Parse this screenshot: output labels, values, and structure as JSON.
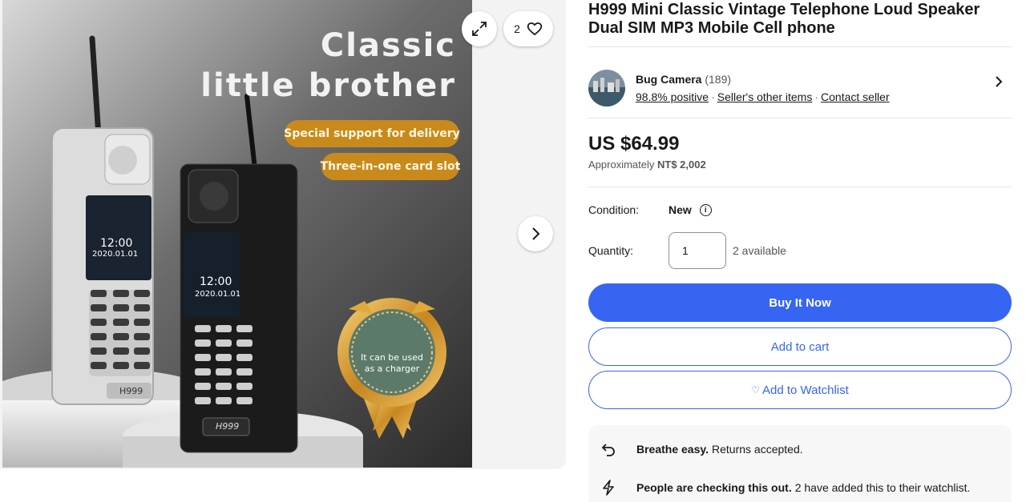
{
  "gallery": {
    "headline_1": "Classic",
    "headline_2": "little brother",
    "badge_1": "Special support for delivery",
    "badge_2": "Three-in-one card slot",
    "seal_text_1": "It can be used",
    "seal_text_2": "as a charger",
    "phone_model": "H999",
    "screen_time": "12:00",
    "screen_date": "2020.01.01",
    "watchers_count": "2",
    "icons": [
      "expand-icon",
      "heart-icon",
      "chevron-right-icon"
    ]
  },
  "listing": {
    "title": "H999 Mini Classic Vintage Telephone Loud Speaker Dual SIM MP3 Mobile Cell phone"
  },
  "seller": {
    "name": "Bug Camera",
    "feedback_count": "(189)",
    "positive": "98.8% positive",
    "other_items": "Seller's other items",
    "contact": "Contact seller"
  },
  "price": {
    "main": "US $64.99",
    "approx_label": "Approximately",
    "approx_value": "NT$ 2,002"
  },
  "condition": {
    "label": "Condition:",
    "value": "New"
  },
  "quantity": {
    "label": "Quantity:",
    "value": "1",
    "available": "2 available"
  },
  "buttons": {
    "buy_now": "Buy It Now",
    "add_to_cart": "Add to cart",
    "add_to_watchlist": "Add to Watchlist"
  },
  "promos": [
    {
      "bold": "Breathe easy.",
      "text": "Returns accepted.",
      "icon": "return-arrow-icon"
    },
    {
      "bold": "People are checking this out.",
      "text": "2 have added this to their watchlist.",
      "icon": "lightning-icon"
    }
  ],
  "colors": {
    "accent": "#3665f3",
    "badge": "#c98a1c",
    "text": "#191919"
  }
}
